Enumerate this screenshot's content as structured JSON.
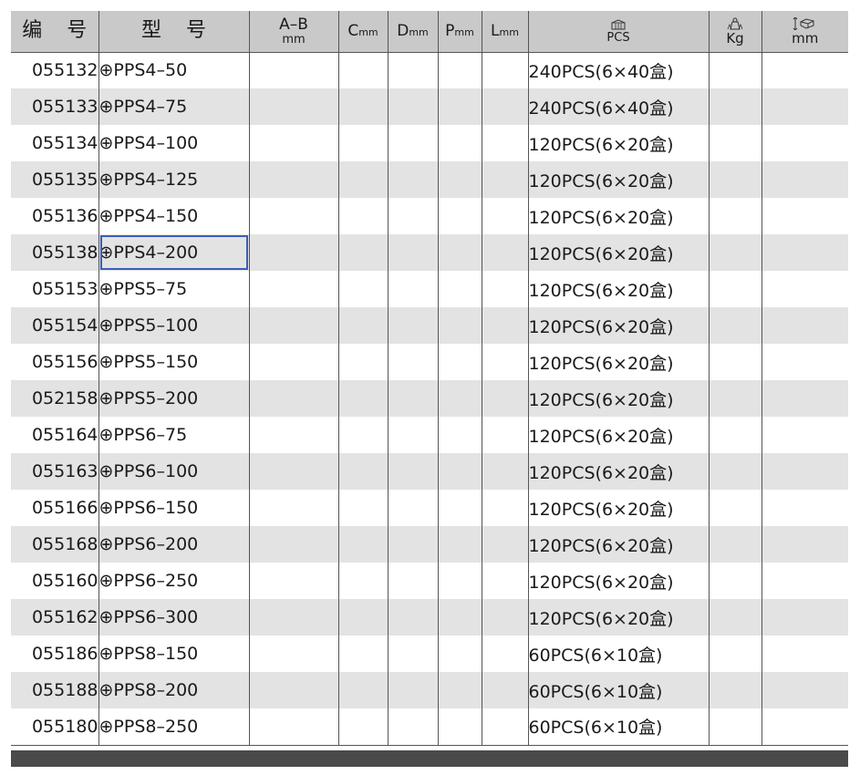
{
  "headers": {
    "code": "编 号",
    "model": "型 号",
    "ab_top": "A–B",
    "ab_unit": "mm",
    "c": "C",
    "d": "D",
    "p": "P",
    "l": "L",
    "unit_mm": "mm",
    "pcs": "PCS",
    "kg": "Kg",
    "length_unit": "mm"
  },
  "icons": {
    "pcs": "carton-box-icon",
    "kg": "weight-icon",
    "length": "box-dimension-icon"
  },
  "colors": {
    "header_bg": "#c9c9c9",
    "stripe_bg": "#e3e3e3",
    "selection": "#3a5fb8",
    "footer_bar": "#4a4a4a"
  },
  "selected_row": 5,
  "rows": [
    {
      "code": "055132",
      "model": "⊕PPS4–50",
      "pack": "240PCS(6×40盒)"
    },
    {
      "code": "055133",
      "model": "⊕PPS4–75",
      "pack": "240PCS(6×40盒)"
    },
    {
      "code": "055134",
      "model": "⊕PPS4–100",
      "pack": "120PCS(6×20盒)"
    },
    {
      "code": "055135",
      "model": "⊕PPS4–125",
      "pack": "120PCS(6×20盒)"
    },
    {
      "code": "055136",
      "model": "⊕PPS4–150",
      "pack": "120PCS(6×20盒)"
    },
    {
      "code": "055138",
      "model": "⊕PPS4–200",
      "pack": "120PCS(6×20盒)"
    },
    {
      "code": "055153",
      "model": "⊕PPS5–75",
      "pack": "120PCS(6×20盒)"
    },
    {
      "code": "055154",
      "model": "⊕PPS5–100",
      "pack": "120PCS(6×20盒)"
    },
    {
      "code": "055156",
      "model": "⊕PPS5–150",
      "pack": "120PCS(6×20盒)"
    },
    {
      "code": "052158",
      "model": "⊕PPS5–200",
      "pack": "120PCS(6×20盒)"
    },
    {
      "code": "055164",
      "model": "⊕PPS6–75",
      "pack": "120PCS(6×20盒)"
    },
    {
      "code": "055163",
      "model": "⊕PPS6–100",
      "pack": "120PCS(6×20盒)"
    },
    {
      "code": "055166",
      "model": "⊕PPS6–150",
      "pack": "120PCS(6×20盒)"
    },
    {
      "code": "055168",
      "model": "⊕PPS6–200",
      "pack": "120PCS(6×20盒)"
    },
    {
      "code": "055160",
      "model": "⊕PPS6–250",
      "pack": "120PCS(6×20盒)"
    },
    {
      "code": "055162",
      "model": "⊕PPS6–300",
      "pack": "120PCS(6×20盒)"
    },
    {
      "code": "055186",
      "model": "⊕PPS8–150",
      "pack": "60PCS(6×10盒)"
    },
    {
      "code": "055188",
      "model": "⊕PPS8–200",
      "pack": "60PCS(6×10盒)"
    },
    {
      "code": "055180",
      "model": "⊕PPS8–250",
      "pack": "60PCS(6×10盒)"
    }
  ]
}
